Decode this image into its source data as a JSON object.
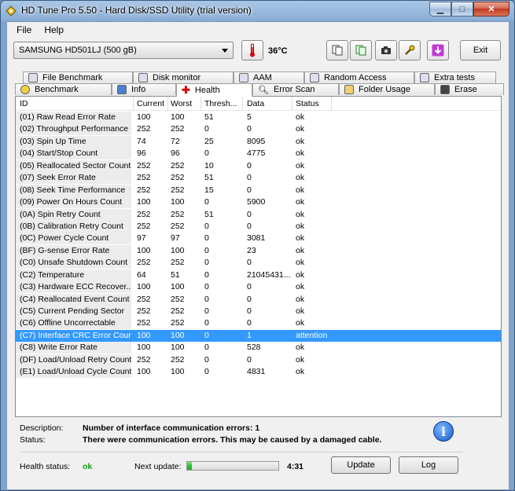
{
  "window": {
    "title": "HD Tune Pro 5.50 - Hard Disk/SSD Utility (trial version)"
  },
  "menu": {
    "file": "File",
    "help": "Help"
  },
  "toolbar": {
    "drive": "SAMSUNG HD501LJ (500 gB)",
    "temperature": "36°C",
    "exit_label": "Exit"
  },
  "tabs_top": [
    "File Benchmark",
    "Disk monitor",
    "AAM",
    "Random Access",
    "Extra tests"
  ],
  "tabs_bottom": [
    "Benchmark",
    "Info",
    "Health",
    "Error Scan",
    "Folder Usage",
    "Erase"
  ],
  "table": {
    "columns": [
      "ID",
      "Current",
      "Worst",
      "Thresh...",
      "Data",
      "Status"
    ],
    "rows": [
      [
        "(01) Raw Read Error Rate",
        "100",
        "100",
        "51",
        "5",
        "ok"
      ],
      [
        "(02) Throughput Performance",
        "252",
        "252",
        "0",
        "0",
        "ok"
      ],
      [
        "(03) Spin Up Time",
        "74",
        "72",
        "25",
        "8095",
        "ok"
      ],
      [
        "(04) Start/Stop Count",
        "96",
        "96",
        "0",
        "4775",
        "ok"
      ],
      [
        "(05) Reallocated Sector Count",
        "252",
        "252",
        "10",
        "0",
        "ok"
      ],
      [
        "(07) Seek Error Rate",
        "252",
        "252",
        "51",
        "0",
        "ok"
      ],
      [
        "(08) Seek Time Performance",
        "252",
        "252",
        "15",
        "0",
        "ok"
      ],
      [
        "(09) Power On Hours Count",
        "100",
        "100",
        "0",
        "5900",
        "ok"
      ],
      [
        "(0A) Spin Retry Count",
        "252",
        "252",
        "51",
        "0",
        "ok"
      ],
      [
        "(0B) Calibration Retry Count",
        "252",
        "252",
        "0",
        "0",
        "ok"
      ],
      [
        "(0C) Power Cycle Count",
        "97",
        "97",
        "0",
        "3081",
        "ok"
      ],
      [
        "(BF) G-sense Error Rate",
        "100",
        "100",
        "0",
        "23",
        "ok"
      ],
      [
        "(C0) Unsafe Shutdown Count",
        "252",
        "252",
        "0",
        "0",
        "ok"
      ],
      [
        "(C2) Temperature",
        "64",
        "51",
        "0",
        "21045431...",
        "ok"
      ],
      [
        "(C3) Hardware ECC Recover...",
        "100",
        "100",
        "0",
        "0",
        "ok"
      ],
      [
        "(C4) Reallocated Event Count",
        "252",
        "252",
        "0",
        "0",
        "ok"
      ],
      [
        "(C5) Current Pending Sector",
        "252",
        "252",
        "0",
        "0",
        "ok"
      ],
      [
        "(C6) Offline Uncorrectable",
        "252",
        "252",
        "0",
        "0",
        "ok"
      ],
      [
        "(C7) Interface CRC Error Count",
        "100",
        "100",
        "0",
        "1",
        "attention"
      ],
      [
        "(C8) Write Error Rate",
        "100",
        "100",
        "0",
        "528",
        "ok"
      ],
      [
        "(DF) Load/Unload Retry Count",
        "252",
        "252",
        "0",
        "0",
        "ok"
      ],
      [
        "(E1) Load/Unload Cycle Count",
        "100",
        "100",
        "0",
        "4831",
        "ok"
      ]
    ],
    "selected_index": 18
  },
  "details": {
    "description_label": "Description:",
    "description": "Number of interface communication errors: 1",
    "status_label": "Status:",
    "status": "There were communication errors. This may be caused by a damaged cable."
  },
  "footer": {
    "health_label": "Health status:",
    "health_value": "ok",
    "next_update_label": "Next update:",
    "progress_fraction": 0.05,
    "countdown": "4:31",
    "update_label": "Update",
    "log_label": "Log"
  },
  "colors": {
    "selection": "#3399ff",
    "ok_green": "#16a016"
  }
}
